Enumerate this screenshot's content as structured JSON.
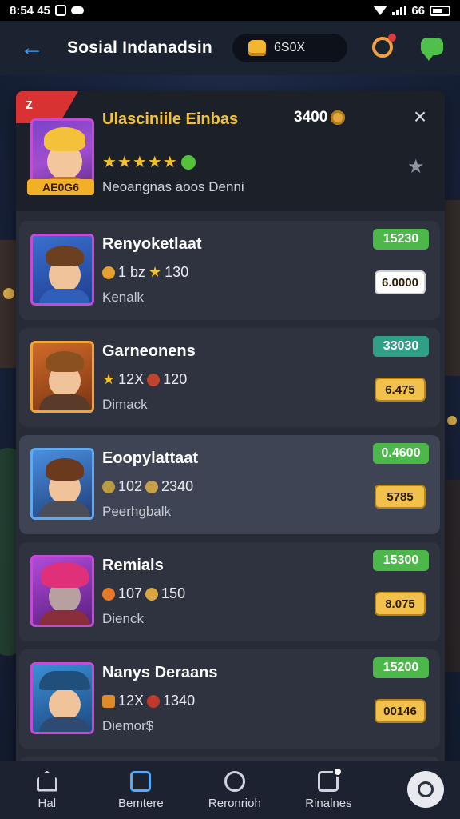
{
  "status_bar": {
    "time": "8:54 45",
    "battery": "66"
  },
  "header": {
    "title": "Sosial Indanadsin",
    "coins": "6S0Х"
  },
  "featured": {
    "ribbon": "z",
    "title": "Ulasciniile Einbas",
    "price": "3400",
    "stars": "★★★★★",
    "badge": "AE0G6",
    "subtitle": "Neoangnas aoos Denni",
    "close": "×",
    "star_button": "★"
  },
  "rows": [
    {
      "name": "Renyoketlaat",
      "stat_a": "1 bz",
      "stat_b": "130",
      "sub": "Kenalk",
      "score": "15230",
      "buy": "6.0000"
    },
    {
      "name": "Garneonens",
      "stat_a": "12X",
      "stat_b": "120",
      "sub": "Dimack",
      "score": "33030",
      "buy": "6.475"
    },
    {
      "name": "Eoopylattaat",
      "stat_a": "102",
      "stat_b": "2340",
      "sub": "Peerhgbalk",
      "score": "0.4600",
      "buy": "5785"
    },
    {
      "name": "Remials",
      "stat_a": "107",
      "stat_b": "150",
      "sub": "Dienck",
      "score": "15300",
      "buy": "8.075"
    },
    {
      "name": "Nanys Deraans",
      "stat_a": "12X",
      "stat_b": "1340",
      "sub": "Diemor$",
      "score": "15200",
      "buy": "00146"
    }
  ],
  "nav": [
    {
      "label": "Hal",
      "icon": "home-icon"
    },
    {
      "label": "Bemtere",
      "icon": "card-icon"
    },
    {
      "label": "Reronrioh",
      "icon": "profile-icon"
    },
    {
      "label": "Rinalnes",
      "icon": "inbox-icon"
    }
  ],
  "colors": {
    "accent": "#3aa4ff",
    "gold": "#f0c238",
    "score_green": "#4cb84a",
    "buy_yellow": "#f1c14b",
    "ribbon_red": "#d83232"
  }
}
